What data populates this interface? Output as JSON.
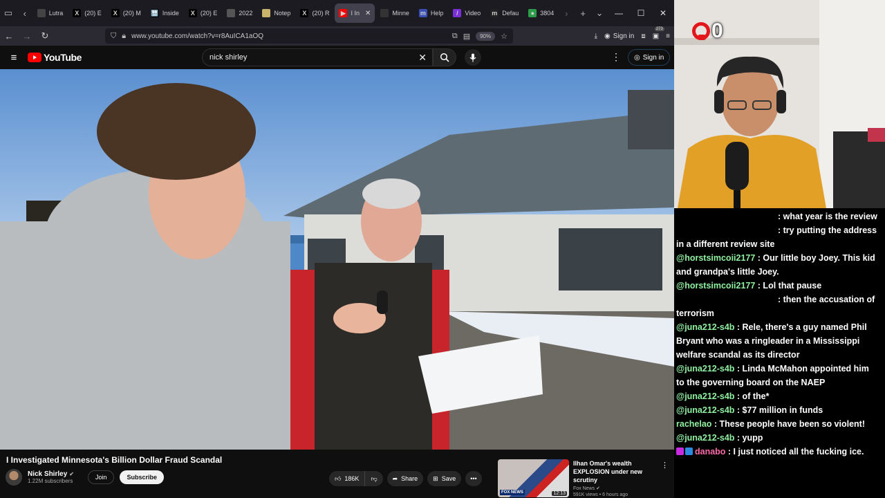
{
  "browser": {
    "tabs": [
      {
        "label": "Lutra",
        "fav": "",
        "fav_color": "#444"
      },
      {
        "label": "(20) E",
        "fav": "X",
        "fav_color": "#000"
      },
      {
        "label": "(20) M",
        "fav": "X",
        "fav_color": "#000"
      },
      {
        "label": "Inside",
        "fav": "🔛",
        "fav_color": "#000"
      },
      {
        "label": "(20) E",
        "fav": "X",
        "fav_color": "#000"
      },
      {
        "label": "2022",
        "fav": "",
        "fav_color": "#555"
      },
      {
        "label": "Notep",
        "fav": "",
        "fav_color": "#c9b36a"
      },
      {
        "label": "(20) R",
        "fav": "X",
        "fav_color": "#000"
      },
      {
        "label": "I In",
        "fav": "▶",
        "fav_color": "#ff0000",
        "active": true
      },
      {
        "label": "Minne",
        "fav": "",
        "fav_color": "#333"
      },
      {
        "label": "Help",
        "fav": "m",
        "fav_color": "#3b4fb8"
      },
      {
        "label": "Video",
        "fav": "/",
        "fav_color": "#7b2fd8"
      },
      {
        "label": "Defau",
        "fav": "m",
        "fav_color": "#222"
      },
      {
        "label": "3804",
        "fav": "●",
        "fav_color": "#2e9d4a"
      }
    ],
    "url": "www.youtube.com/watch?v=r8AuICA1aOQ",
    "zoom": "90%",
    "signin": "Sign in",
    "badge": "273"
  },
  "youtube": {
    "logo": "YouTube",
    "search_value": "nick shirley",
    "signin": "Sign in",
    "video": {
      "title": "I Investigated Minnesota's Billion Dollar Fraud Scandal",
      "channel": "Nick Shirley",
      "subscribers": "1.22M subscribers",
      "join": "Join",
      "subscribe": "Subscribe",
      "likes": "186K",
      "share": "Share",
      "save": "Save"
    },
    "recommended": {
      "title": "Ilhan Omar's wealth EXPLOSION under new scrutiny",
      "channel": "Fox News",
      "meta": "591K views • 6 hours ago",
      "duration": "12:13",
      "thumb_badge": "FOX NEWS"
    }
  },
  "stream": {
    "score": "0",
    "chat": [
      {
        "user": "",
        "text": ": what year is the review",
        "indent": 147
      },
      {
        "user": "",
        "text": ": try putting the address in a different review site",
        "indent": 147
      },
      {
        "user": "@horstsimcoii2177",
        "text": " : Our little boy Joey. This kid and grandpa's little Joey.",
        "indent": 0
      },
      {
        "user": "@horstsimcoii2177",
        "text": " : Lol that pause",
        "indent": 0
      },
      {
        "user": "",
        "text": ": then the accusation of terrorism",
        "indent": 147
      },
      {
        "user": "@juna212-s4b",
        "text": " : Rele, there's a guy named Phil Bryant who was a ringleader in a Mississippi welfare scandal as its director",
        "indent": 0
      },
      {
        "user": "@juna212-s4b",
        "text": " : Linda McMahon appointed him to the governing board on the NAEP",
        "indent": 0
      },
      {
        "user": "@juna212-s4b",
        "text": " : of the*",
        "indent": 0
      },
      {
        "user": "@juna212-s4b",
        "text": " : $77 million in funds",
        "indent": 0
      },
      {
        "user": "rachelao",
        "text": " : These people have been so violent!",
        "indent": 0
      },
      {
        "user": "@juna212-s4b",
        "text": " : yupp",
        "indent": 0
      },
      {
        "user": "danabo",
        "text": " : I just noticed all the fucking ice.",
        "indent": 0,
        "badges": true,
        "pink": true
      }
    ]
  }
}
